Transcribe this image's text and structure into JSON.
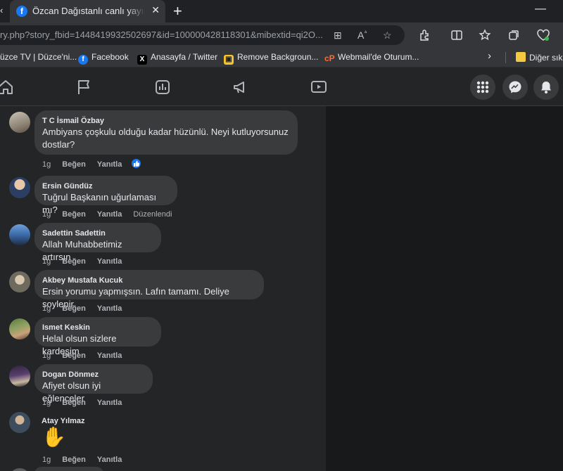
{
  "browser": {
    "tab_title": "Özcan Dağıstanlı canlı yayındaydı",
    "url": "ry.php?story_fbid=1448419932502697&id=100000428118301&mibextid=qi2O...",
    "bookmarks": [
      {
        "label": "üzce TV | Düzce'ni..."
      },
      {
        "label": "Facebook"
      },
      {
        "label": "Anasayfa / Twitter"
      },
      {
        "label": "Remove Backgroun..."
      },
      {
        "label": "Webmail'de Oturum..."
      }
    ],
    "other_bookmarks": "Diğer sık"
  },
  "comments": [
    {
      "author": "T C İsmail Özbay",
      "text_lines": [
        "Ambiyans çoşkulu olduğu kadar hüzünlü. Neyi kutluyorsunuz",
        "dostlar?"
      ],
      "time": "1g",
      "like": "Beğen",
      "reply": "Yanıtla",
      "reaction": "like"
    },
    {
      "author": "Ersin Gündüz",
      "text_lines": [
        "Tuğrul Başkanın uğurlaması mı?"
      ],
      "time": "1g",
      "like": "Beğen",
      "reply": "Yanıtla",
      "edited": "Düzenlendi"
    },
    {
      "author": "Sadettin Sadettin",
      "text_lines": [
        "Allah Muhabbetimiz artırsın"
      ],
      "time": "1g",
      "like": "Beğen",
      "reply": "Yanıtla"
    },
    {
      "author": "Akbey Mustafa Kucuk",
      "text_lines": [
        "Ersin yorumu yapmışsın. Lafın tamamı. Deliye soylenir"
      ],
      "time": "1g",
      "like": "Beğen",
      "reply": "Yanıtla"
    },
    {
      "author": "Ismet Keskin",
      "text_lines": [
        "Helal olsun sizlere kardeşim"
      ],
      "time": "1g",
      "like": "Beğen",
      "reply": "Yanıtla"
    },
    {
      "author": "Dogan Dönmez",
      "text_lines": [
        "Afiyet olsun iyi eğlenceler"
      ],
      "time": "1g",
      "like": "Beğen",
      "reply": "Yanıtla"
    },
    {
      "author": "Atay Yılmaz",
      "emoji": "✋",
      "time": "1g",
      "like": "Beğen",
      "reply": "Yanıtla"
    }
  ],
  "colors": {
    "accent": "#1877f2",
    "bubble": "#3a3b3c",
    "panel": "#242526"
  }
}
